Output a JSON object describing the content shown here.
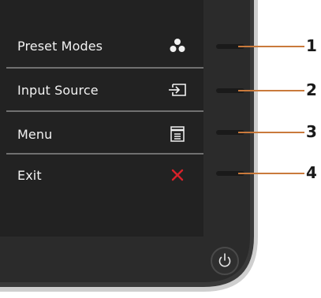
{
  "menu": {
    "items": [
      {
        "label": "Preset Modes",
        "icon": "preset-modes-icon"
      },
      {
        "label": "Input Source",
        "icon": "input-source-icon"
      },
      {
        "label": "Menu",
        "icon": "menu-icon"
      },
      {
        "label": "Exit",
        "icon": "exit-icon"
      }
    ]
  },
  "callouts": [
    "1",
    "2",
    "3",
    "4"
  ],
  "power_button": {
    "icon": "power-icon"
  },
  "colors": {
    "panel": "#262626",
    "bezel": "#2e2e2e",
    "bezel_edge": "#c9c9c9",
    "callout_line": "#c97a3c",
    "exit_accent": "#d7222a",
    "text": "#f2f2f2"
  }
}
